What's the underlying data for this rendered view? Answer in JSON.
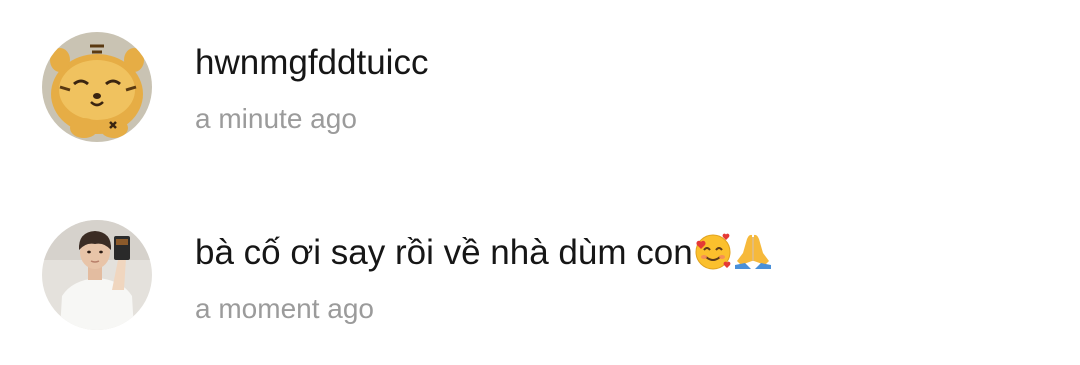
{
  "comments": [
    {
      "avatar_icon": "tiger-plush-avatar",
      "text": "hwnmgfddtuicc",
      "time": "a minute ago"
    },
    {
      "avatar_icon": "person-avatar",
      "text": "bà cố ơi say rồi về nhà dùm con",
      "emojis": [
        "smiling-face-with-hearts-emoji",
        "folded-hands-emoji"
      ],
      "time": "a moment ago"
    }
  ],
  "colors": {
    "text": "#161616",
    "timestamp": "#9b9b9b",
    "background": "#ffffff"
  }
}
